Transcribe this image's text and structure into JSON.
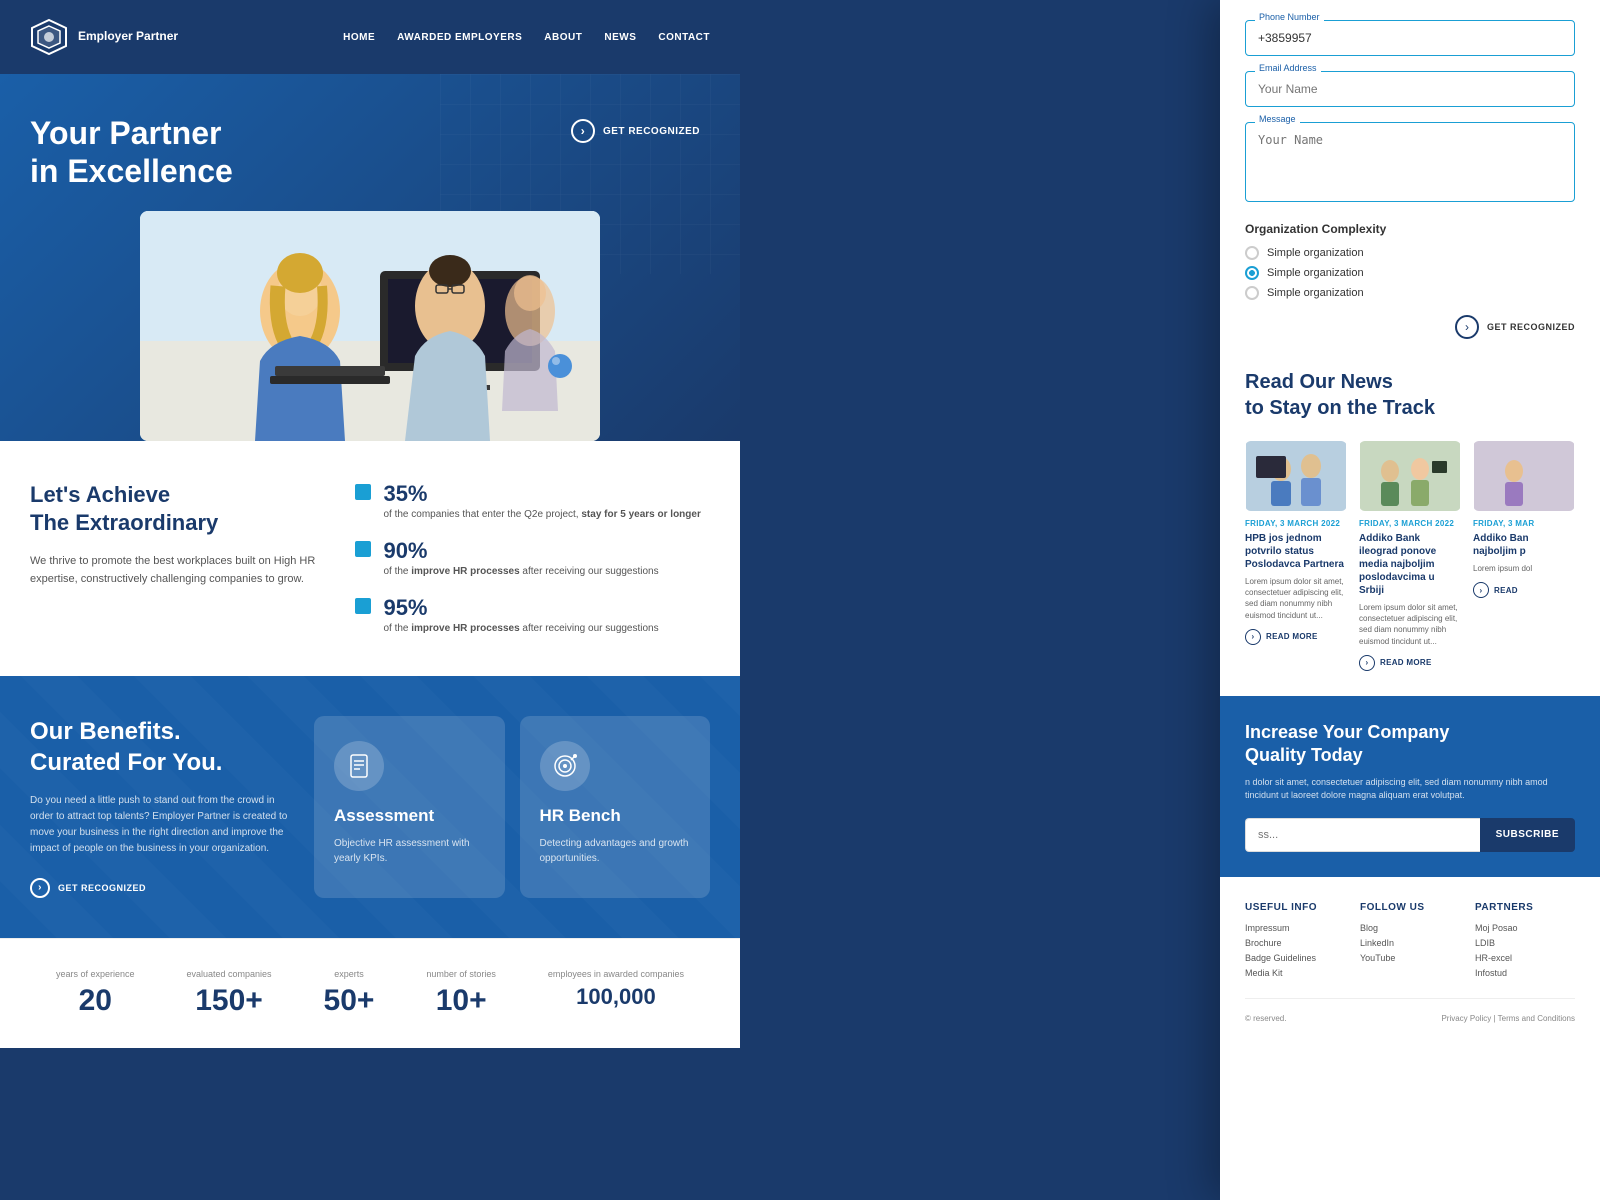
{
  "brand": {
    "name": "Employer Partner",
    "logo_alt": "Employer Partner Logo"
  },
  "nav": {
    "items": [
      {
        "label": "HOME",
        "href": "#"
      },
      {
        "label": "AWARDED EMPLOYERS",
        "href": "#"
      },
      {
        "label": "ABOUT",
        "href": "#"
      },
      {
        "label": "NEWS",
        "href": "#"
      },
      {
        "label": "CONTACT",
        "href": "#"
      }
    ]
  },
  "hero": {
    "title_line1": "Your Partner",
    "title_line2": "in Excellence",
    "cta_label": "GET RECOGNIZED"
  },
  "stats": {
    "heading_line1": "Let's Achieve",
    "heading_line2": "The Extraordinary",
    "description": "We thrive to promote the best workplaces built on High HR expertise, constructively challenging companies to grow.",
    "items": [
      {
        "percent": "35%",
        "description_pre": "of the companies that enter the Q2e project,",
        "description_bold": "stay for 5 years or longer"
      },
      {
        "percent": "90%",
        "description_pre": "of the",
        "description_bold": "improve HR processes",
        "description_post": "after receiving our suggestions"
      },
      {
        "percent": "95%",
        "description_pre": "of the",
        "description_bold": "improve HR processes",
        "description_post": "after receiving our suggestions"
      }
    ]
  },
  "benefits": {
    "heading_line1": "Our Benefits.",
    "heading_line2": "Curated For You.",
    "description": "Do you need a little push to stand out from the crowd in order to attract top talents? Employer Partner is created to move your business in the right direction and improve the impact of people on the business in your organization.",
    "cta_label": "GET RECOGNIZED",
    "cards": [
      {
        "icon": "📄",
        "title": "Assessment",
        "description": "Objective HR assessment with yearly KPIs."
      },
      {
        "icon": "🎯",
        "title": "HR Bench",
        "description": "Detecting advantages and growth opportunities."
      }
    ]
  },
  "stats_bottom": [
    {
      "label": "years of experience",
      "value": "20"
    },
    {
      "label": "evaluated companies",
      "value": "150+"
    },
    {
      "label": "experts",
      "value": "50+"
    },
    {
      "label": "number of stories",
      "value": "10+"
    },
    {
      "label": "employees in awarded companies",
      "value": "100,000"
    }
  ],
  "form": {
    "phone_label": "Phone Number",
    "phone_value": "+3859957",
    "email_label": "Email Address",
    "email_placeholder": "Your Name",
    "message_label": "Message",
    "message_placeholder": "Your Name",
    "org_complexity_title": "Organization Complexity",
    "org_options": [
      {
        "label": "Simple organization",
        "selected": false
      },
      {
        "label": "Simple organization",
        "selected": true
      },
      {
        "label": "Simple organization",
        "selected": false
      }
    ],
    "cta_label": "GET RECOGNIZED"
  },
  "news": {
    "heading_line1": "Read Our News",
    "heading_line2": "to Stay on the Track",
    "articles": [
      {
        "date": "FRIDAY, 3 MARCH 2022",
        "headline": "HPB jos jednom potvrilo status Poslodavca Partnera",
        "excerpt": "Lorem ipsum dolor sit amet, consectetuer adipiscing elit, sed diam nonummy nibh euismod tincidunt ut...",
        "read_more": "READ MORE",
        "img_bg": "linear-gradient(135deg, #b8cfe0 0%, #d0e5f5 100%)"
      },
      {
        "date": "FRIDAY, 3 MARCH 2022",
        "headline": "Addiko Bank ileograd ponove media najboljim poslodavcima u Srbiji",
        "excerpt": "Lorem ipsum dolor sit amet, consectetuer adipiscing elit, sed diam nonummy nibh euismod tincidunt ut...",
        "read_more": "READ MORE",
        "img_bg": "linear-gradient(135deg, #c8d8c0 0%, #e0f0d8 100%)"
      },
      {
        "date": "FRIDAY, 3 MAR",
        "headline": "Addiko Ban najboljim p",
        "excerpt": "Lorem ipsum dol",
        "read_more": "READ",
        "img_bg": "linear-gradient(135deg, #d0c8d8 0%, #e8e0f0 100%)"
      }
    ]
  },
  "subscribe": {
    "heading_line1": "Increase Your Company",
    "heading_line2": "Quality Today",
    "description": "n dolor sit amet, consectetuer adipiscing elit, sed diam nonummy nibh amod tincidunt ut laoreet dolore magna aliquam erat volutpat.",
    "input_placeholder": "ss...",
    "button_label": "SUBSCRIBE"
  },
  "footer": {
    "columns": [
      {
        "heading": "USEFUL INFO",
        "links": [
          "Impressum",
          "Brochure",
          "Badge Guidelines",
          "Media Kit"
        ]
      },
      {
        "heading": "FOLLOW US",
        "links": [
          "Blog",
          "LinkedIn",
          "YouTube"
        ]
      },
      {
        "heading": "PARTNERS",
        "links": [
          "Moj Posao",
          "LDIB",
          "HR-excel",
          "Infostud"
        ]
      }
    ],
    "copyright": "© reserved.",
    "legal": "Privacy Policy | Terms and Conditions"
  },
  "colors": {
    "primary_dark": "#1a3a6b",
    "primary_blue": "#1a5fa8",
    "accent_blue": "#1a9fd4",
    "white": "#ffffff"
  }
}
